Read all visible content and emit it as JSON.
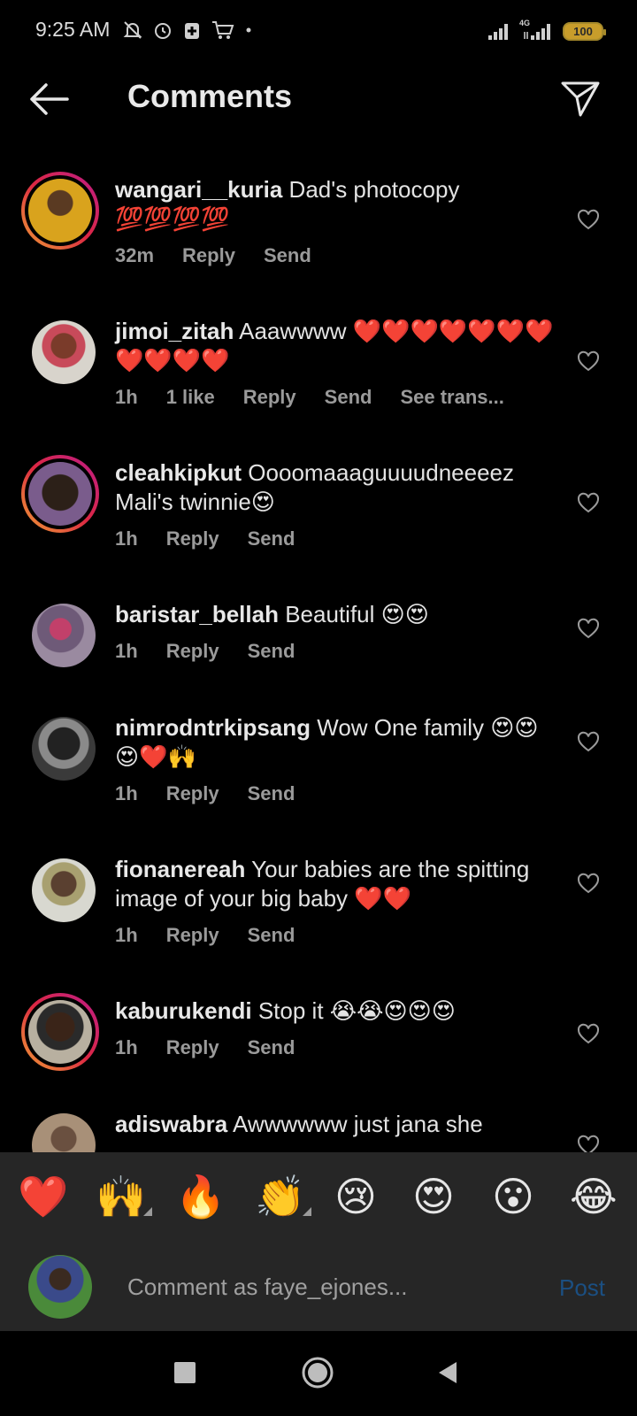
{
  "status_bar": {
    "time": "9:25 AM",
    "network": "4G",
    "battery": "100"
  },
  "header": {
    "title": "Comments"
  },
  "comments": [
    {
      "username": "wangari__kuria",
      "text": "Dad's photocopy 💯💯💯💯",
      "time": "32m",
      "likes": "",
      "reply": "Reply",
      "send": "Send",
      "translate": ""
    },
    {
      "username": "jimoi_zitah",
      "text": "Aaawwww ❤️❤️❤️❤️❤️❤️❤️❤️❤️❤️❤️",
      "time": "1h",
      "likes": "1 like",
      "reply": "Reply",
      "send": "Send",
      "translate": "See trans..."
    },
    {
      "username": "cleahkipkut",
      "text": "Oooomaaaguuuudneeeez Mali's twinnie😍",
      "time": "1h",
      "likes": "",
      "reply": "Reply",
      "send": "Send",
      "translate": ""
    },
    {
      "username": "baristar_bellah",
      "text": "Beautiful 😍😍",
      "time": "1h",
      "likes": "",
      "reply": "Reply",
      "send": "Send",
      "translate": ""
    },
    {
      "username": "nimrodntrkipsang",
      "text": "Wow One family 😍😍😍❤️🙌",
      "time": "1h",
      "likes": "",
      "reply": "Reply",
      "send": "Send",
      "translate": ""
    },
    {
      "username": "fionanereah",
      "text": "Your babies are the spitting image of your big baby ❤️❤️",
      "time": "1h",
      "likes": "",
      "reply": "Reply",
      "send": "Send",
      "translate": ""
    },
    {
      "username": "kaburukendi",
      "text": "Stop it 😭😭😍😍😍",
      "time": "1h",
      "likes": "",
      "reply": "Reply",
      "send": "Send",
      "translate": ""
    },
    {
      "username": "adiswabra",
      "text": "Awwwwww just jana she",
      "time": "",
      "likes": "",
      "reply": "",
      "send": "",
      "translate": ""
    }
  ],
  "emoji_bar": [
    "❤️",
    "🙌",
    "🔥",
    "👏",
    "😢",
    "😍",
    "😮",
    "😂"
  ],
  "composer": {
    "placeholder": "Comment as faye_ejones...",
    "post_label": "Post"
  },
  "colors": {
    "background": "#000000",
    "panel": "#262626",
    "post_disabled": "#1b4f82",
    "muted_text": "#9a9a9a"
  }
}
